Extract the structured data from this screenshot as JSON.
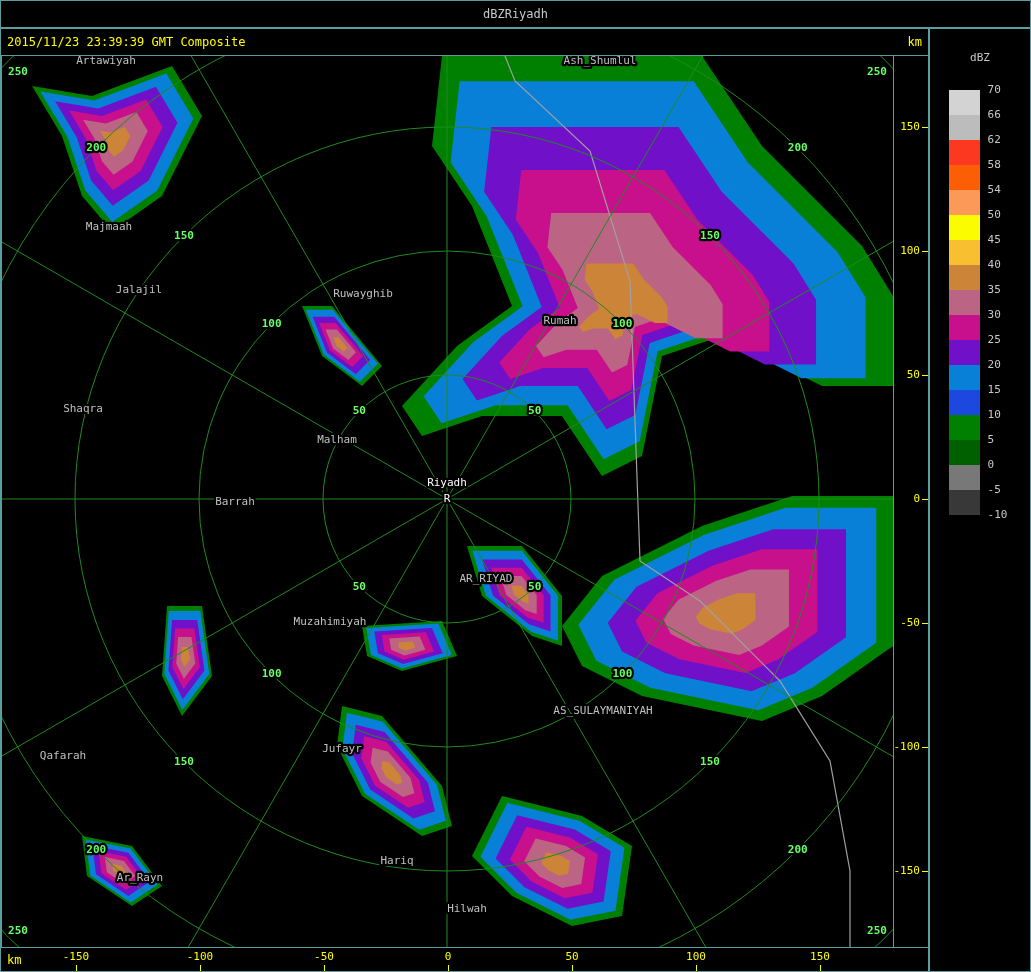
{
  "window": {
    "title": "dBZRiyadh"
  },
  "header": {
    "timestamp": "2015/11/23 23:39:39 GMT Composite",
    "unit": "km"
  },
  "map": {
    "site_marker": "R",
    "places": [
      {
        "name": "Artawiyah",
        "kind": "town"
      },
      {
        "name": "Ash_Shumlul",
        "kind": "town"
      },
      {
        "name": "Majmaah",
        "kind": "town"
      },
      {
        "name": "Jalajil",
        "kind": "town"
      },
      {
        "name": "Ruwayghib",
        "kind": "town"
      },
      {
        "name": "Rumah",
        "kind": "town"
      },
      {
        "name": "Shaqra",
        "kind": "town"
      },
      {
        "name": "Malham",
        "kind": "town"
      },
      {
        "name": "Riyadh",
        "kind": "site"
      },
      {
        "name": "Barrah",
        "kind": "town"
      },
      {
        "name": "AR_RIYAD",
        "kind": "town"
      },
      {
        "name": "Muzahimiyah",
        "kind": "town"
      },
      {
        "name": "AS_SULAYMANIYAH",
        "kind": "town"
      },
      {
        "name": "Jufayr",
        "kind": "town"
      },
      {
        "name": "Qafarah",
        "kind": "town"
      },
      {
        "name": "Hariq",
        "kind": "town"
      },
      {
        "name": "Ar_Rayn",
        "kind": "town"
      },
      {
        "name": "Hilwah",
        "kind": "town"
      }
    ],
    "range_rings": [
      {
        "labels": [
          "50",
          "50",
          "50",
          "50"
        ]
      },
      {
        "labels": [
          "100",
          "100",
          "100",
          "100"
        ]
      },
      {
        "labels": [
          "150",
          "150",
          "150",
          "150"
        ]
      },
      {
        "labels": [
          "200",
          "200",
          "200",
          "200"
        ]
      },
      {
        "labels": [
          "250",
          "250",
          "250",
          "250"
        ]
      }
    ]
  },
  "y_axis": {
    "ticks": [
      "150",
      "100",
      "50",
      "0",
      "-50",
      "-100",
      "-150"
    ]
  },
  "x_axis": {
    "unit": "km",
    "ticks": [
      "-150",
      "-100",
      "-50",
      "0",
      "50",
      "100",
      "150"
    ]
  },
  "legend": {
    "title": "dBZ",
    "top_label": "70",
    "bins": [
      {
        "color": "#d3d3d3",
        "label": "66"
      },
      {
        "color": "#bcbcbc",
        "label": "62"
      },
      {
        "color": "#fc3820",
        "label": "58"
      },
      {
        "color": "#fc5e05",
        "label": "54"
      },
      {
        "color": "#fc9858",
        "label": "50"
      },
      {
        "color": "#fcfc00",
        "label": "45"
      },
      {
        "color": "#f8c030",
        "label": "40"
      },
      {
        "color": "#cc8438",
        "label": "35"
      },
      {
        "color": "#bc6484",
        "label": "30"
      },
      {
        "color": "#c8108c",
        "label": "25"
      },
      {
        "color": "#7010c8",
        "label": "20"
      },
      {
        "color": "#0880d8",
        "label": "15"
      },
      {
        "color": "#1c48e0",
        "label": "10"
      },
      {
        "color": "#008000",
        "label": "5"
      },
      {
        "color": "#006000",
        "label": "0"
      },
      {
        "color": "#787878",
        "label": "-5"
      },
      {
        "color": "#383838",
        "label": "-10"
      }
    ]
  }
}
